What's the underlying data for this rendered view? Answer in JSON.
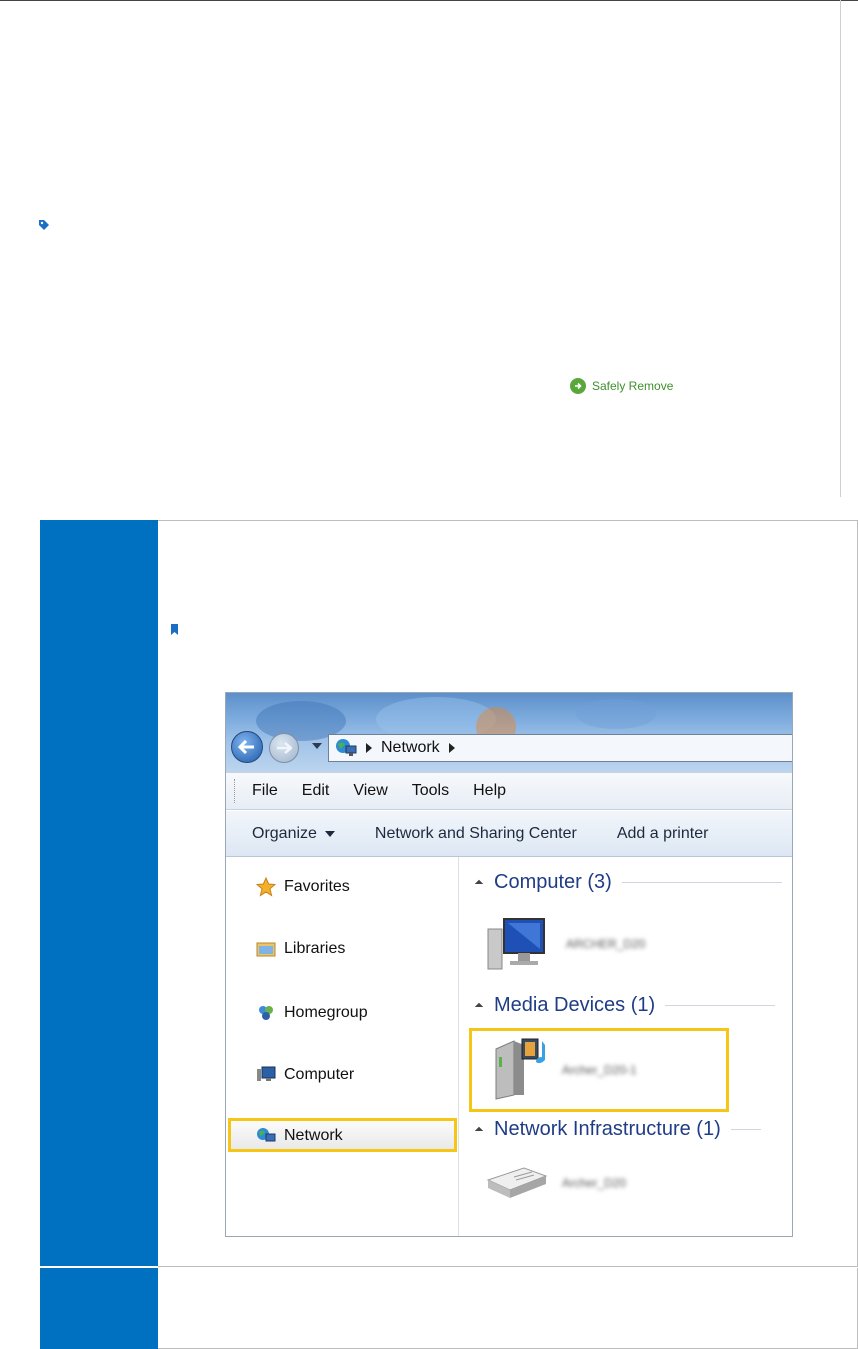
{
  "page": {
    "safely_remove": "Safely Remove"
  },
  "explorer": {
    "address": {
      "crumb": "Network"
    },
    "menu": [
      "File",
      "Edit",
      "View",
      "Tools",
      "Help"
    ],
    "commands": {
      "organize": "Organize",
      "network_sharing": "Network and Sharing Center",
      "add_printer": "Add a printer"
    },
    "nav_pane": {
      "favorites": "Favorites",
      "libraries": "Libraries",
      "homegroup": "Homegroup",
      "computer": "Computer",
      "network": "Network"
    },
    "groups": {
      "computer": "Computer (3)",
      "media": "Media Devices (1)",
      "infra": "Network Infrastructure (1)"
    },
    "devices": {
      "computer": "ARCHER_D20",
      "media": "Archer_D20-1",
      "infra": "Archer_D20"
    },
    "colors": {
      "highlight": "#f5c518",
      "group_heading": "#1f3c87"
    }
  },
  "colors": {
    "table_left_column": "#0070c0",
    "safely_remove_green": "#5aa83c"
  }
}
